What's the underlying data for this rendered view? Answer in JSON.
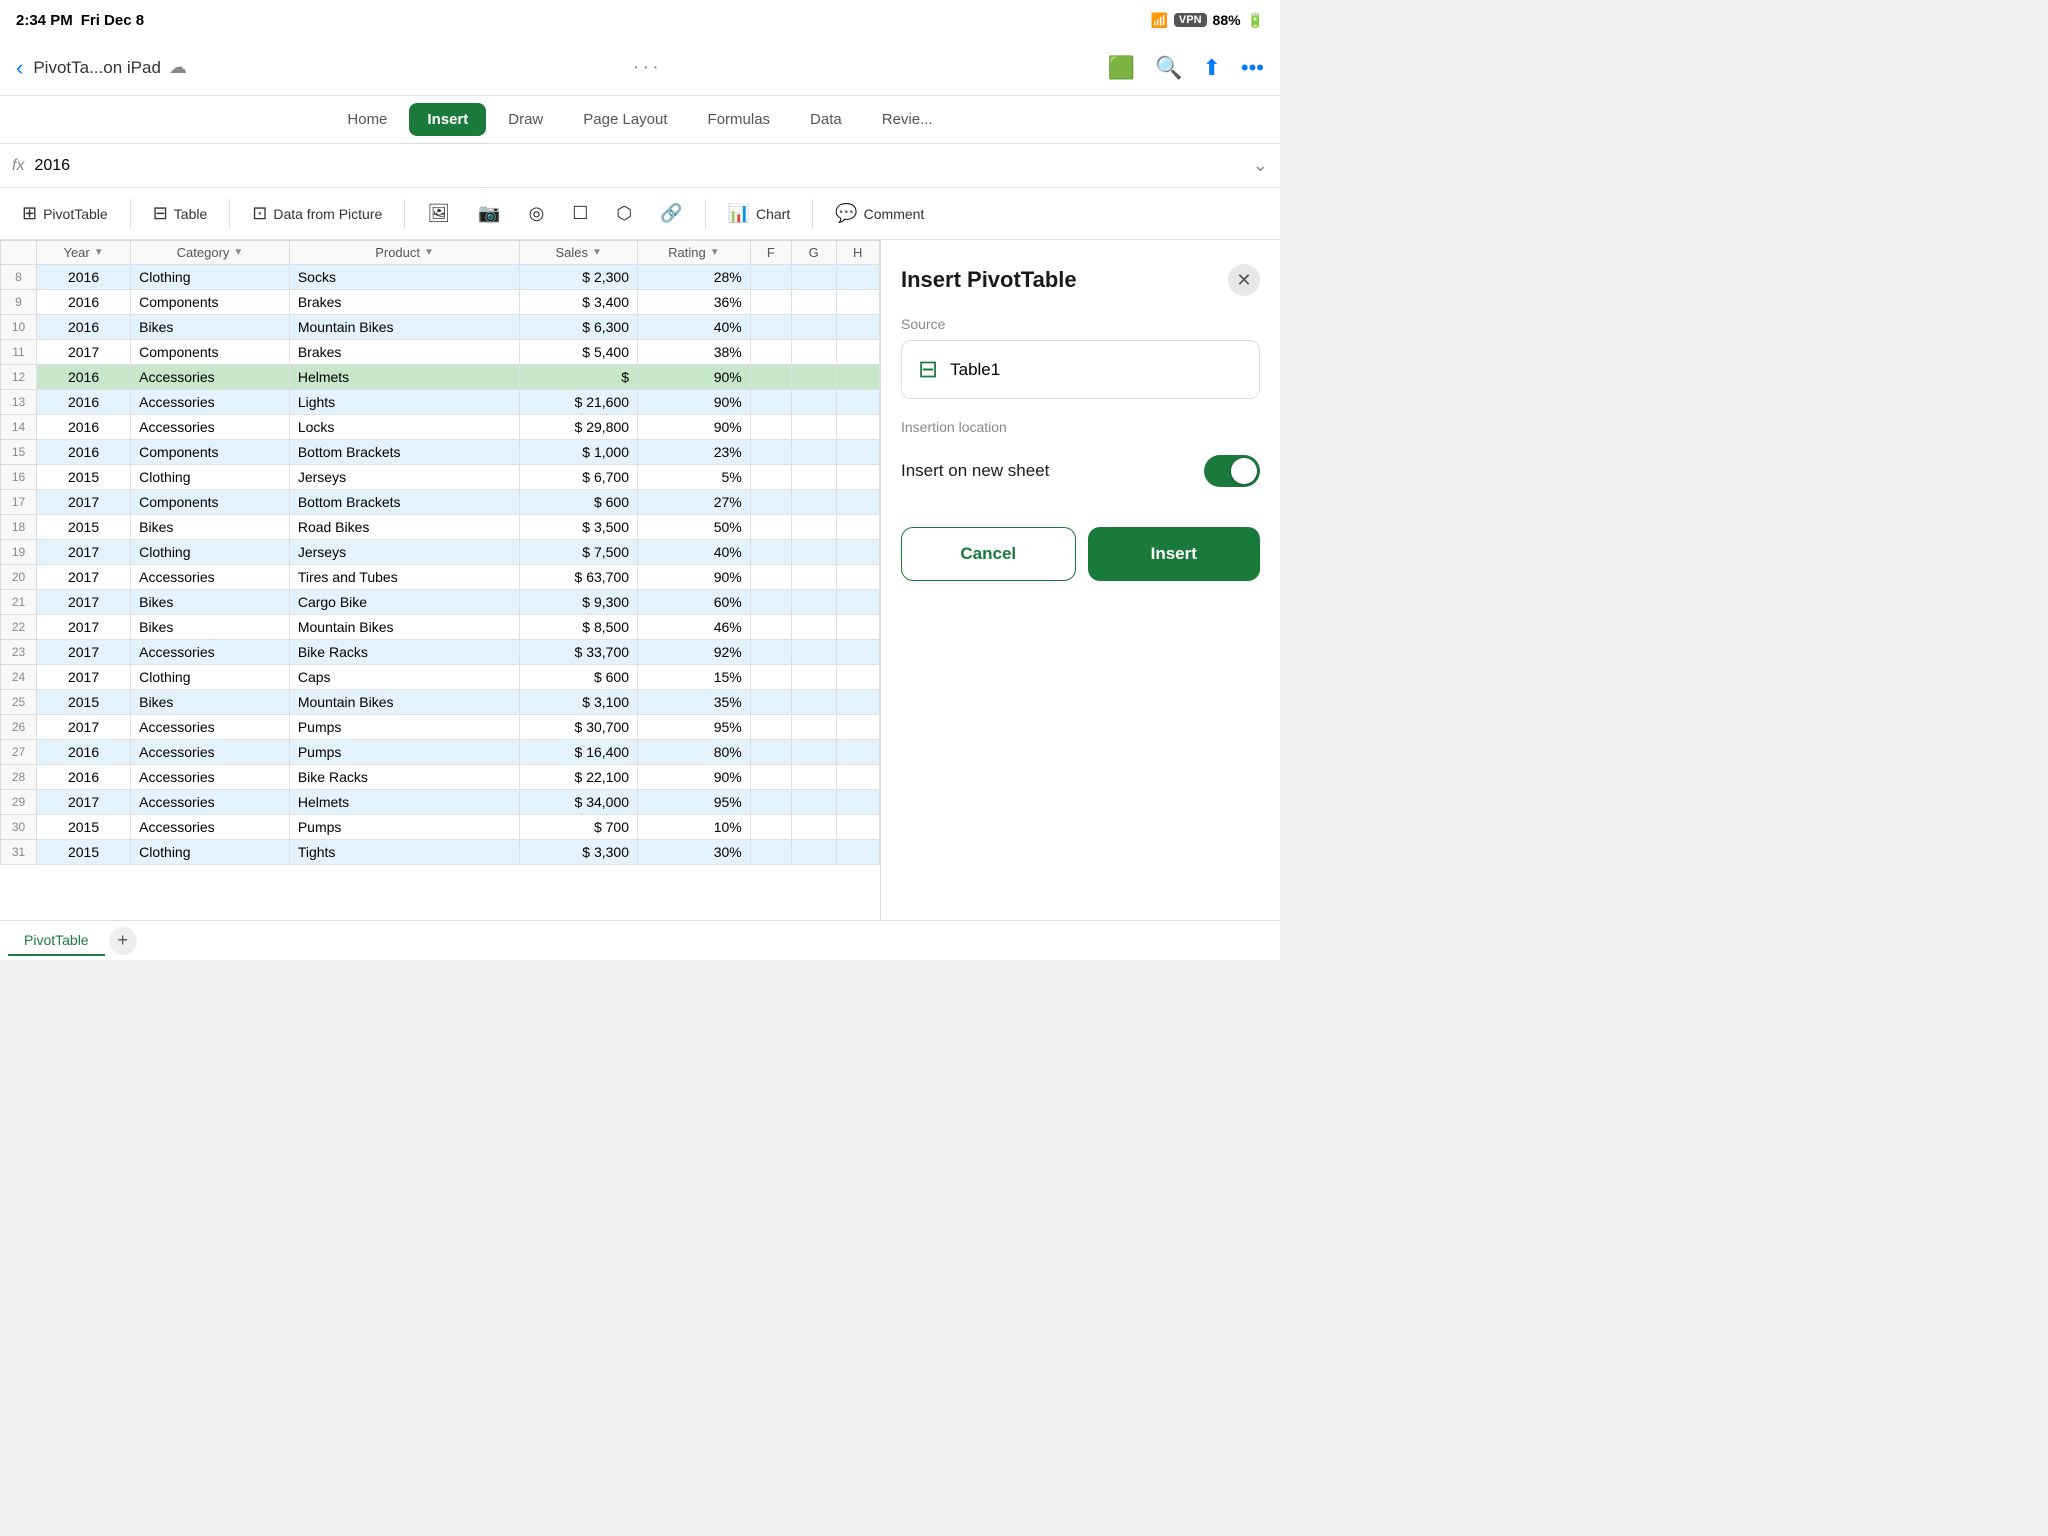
{
  "statusBar": {
    "time": "2:34 PM",
    "day": "Fri Dec 8",
    "vpn": "VPN",
    "battery": "88%",
    "batteryIcon": "🔋"
  },
  "titleBar": {
    "fileName": "PivotTa...on iPad",
    "backLabel": "‹"
  },
  "tabs": [
    {
      "id": "home",
      "label": "Home",
      "active": false
    },
    {
      "id": "insert",
      "label": "Insert",
      "active": true
    },
    {
      "id": "draw",
      "label": "Draw",
      "active": false
    },
    {
      "id": "pageLayout",
      "label": "Page Layout",
      "active": false
    },
    {
      "id": "formulas",
      "label": "Formulas",
      "active": false
    },
    {
      "id": "data",
      "label": "Data",
      "active": false
    },
    {
      "id": "review",
      "label": "Revie...",
      "active": false
    }
  ],
  "formulaBar": {
    "fx": "fx",
    "value": "2016"
  },
  "toolbar": {
    "items": [
      {
        "id": "pivottable",
        "label": "PivotTable",
        "icon": "⊞"
      },
      {
        "id": "table",
        "label": "Table",
        "icon": "⊟"
      },
      {
        "id": "datafrompicture",
        "label": "Data from Picture",
        "icon": "⊡"
      },
      {
        "id": "images",
        "label": "",
        "icon": "🖼"
      },
      {
        "id": "camera",
        "label": "",
        "icon": "📷"
      },
      {
        "id": "shapes",
        "label": "",
        "icon": "⬠"
      },
      {
        "id": "textbox",
        "label": "",
        "icon": "☐"
      },
      {
        "id": "scanner",
        "label": "",
        "icon": "⊞"
      },
      {
        "id": "links",
        "label": "",
        "icon": "🔗"
      },
      {
        "id": "chart",
        "label": "Chart",
        "icon": "📊"
      },
      {
        "id": "comment",
        "label": "Comment",
        "icon": "💬"
      }
    ]
  },
  "columns": [
    {
      "id": "year",
      "label": "Year",
      "hasFilter": true
    },
    {
      "id": "category",
      "label": "Category",
      "hasFilter": true
    },
    {
      "id": "product",
      "label": "Product",
      "hasFilter": true
    },
    {
      "id": "sales",
      "label": "Sales",
      "hasFilter": true
    },
    {
      "id": "rating",
      "label": "Rating",
      "hasFilter": true
    },
    {
      "id": "f",
      "label": "F",
      "hasFilter": false
    },
    {
      "id": "g",
      "label": "G",
      "hasFilter": false
    },
    {
      "id": "h",
      "label": "H",
      "hasFilter": false
    }
  ],
  "rows": [
    {
      "num": 8,
      "year": "2016",
      "category": "Clothing",
      "product": "Socks",
      "sales": "$ 2,300",
      "rating": "28%",
      "highlight": "blue"
    },
    {
      "num": 9,
      "year": "2016",
      "category": "Components",
      "product": "Brakes",
      "sales": "$ 3,400",
      "rating": "36%",
      "highlight": "normal"
    },
    {
      "num": 10,
      "year": "2016",
      "category": "Bikes",
      "product": "Mountain Bikes",
      "sales": "$ 6,300",
      "rating": "40%",
      "highlight": "blue"
    },
    {
      "num": 11,
      "year": "2017",
      "category": "Components",
      "product": "Brakes",
      "sales": "$ 5,400",
      "rating": "38%",
      "highlight": "normal"
    },
    {
      "num": 12,
      "year": "2016",
      "category": "Accessories",
      "product": "Helmets",
      "sales": "$",
      "rating": "90%",
      "highlight": "selected"
    },
    {
      "num": 13,
      "year": "2016",
      "category": "Accessories",
      "product": "Lights",
      "sales": "$ 21,600",
      "rating": "90%",
      "highlight": "blue"
    },
    {
      "num": 14,
      "year": "2016",
      "category": "Accessories",
      "product": "Locks",
      "sales": "$ 29,800",
      "rating": "90%",
      "highlight": "normal"
    },
    {
      "num": 15,
      "year": "2016",
      "category": "Components",
      "product": "Bottom Brackets",
      "sales": "$ 1,000",
      "rating": "23%",
      "highlight": "blue"
    },
    {
      "num": 16,
      "year": "2015",
      "category": "Clothing",
      "product": "Jerseys",
      "sales": "$ 6,700",
      "rating": "5%",
      "highlight": "normal"
    },
    {
      "num": 17,
      "year": "2017",
      "category": "Components",
      "product": "Bottom Brackets",
      "sales": "$ 600",
      "rating": "27%",
      "highlight": "blue"
    },
    {
      "num": 18,
      "year": "2015",
      "category": "Bikes",
      "product": "Road Bikes",
      "sales": "$ 3,500",
      "rating": "50%",
      "highlight": "normal"
    },
    {
      "num": 19,
      "year": "2017",
      "category": "Clothing",
      "product": "Jerseys",
      "sales": "$ 7,500",
      "rating": "40%",
      "highlight": "blue"
    },
    {
      "num": 20,
      "year": "2017",
      "category": "Accessories",
      "product": "Tires and Tubes",
      "sales": "$ 63,700",
      "rating": "90%",
      "highlight": "normal"
    },
    {
      "num": 21,
      "year": "2017",
      "category": "Bikes",
      "product": "Cargo Bike",
      "sales": "$ 9,300",
      "rating": "60%",
      "highlight": "blue"
    },
    {
      "num": 22,
      "year": "2017",
      "category": "Bikes",
      "product": "Mountain Bikes",
      "sales": "$ 8,500",
      "rating": "46%",
      "highlight": "normal"
    },
    {
      "num": 23,
      "year": "2017",
      "category": "Accessories",
      "product": "Bike Racks",
      "sales": "$ 33,700",
      "rating": "92%",
      "highlight": "blue"
    },
    {
      "num": 24,
      "year": "2017",
      "category": "Clothing",
      "product": "Caps",
      "sales": "$ 600",
      "rating": "15%",
      "highlight": "normal"
    },
    {
      "num": 25,
      "year": "2015",
      "category": "Bikes",
      "product": "Mountain Bikes",
      "sales": "$ 3,100",
      "rating": "35%",
      "highlight": "blue"
    },
    {
      "num": 26,
      "year": "2017",
      "category": "Accessories",
      "product": "Pumps",
      "sales": "$ 30,700",
      "rating": "95%",
      "highlight": "normal"
    },
    {
      "num": 27,
      "year": "2016",
      "category": "Accessories",
      "product": "Pumps",
      "sales": "$ 16,400",
      "rating": "80%",
      "highlight": "blue"
    },
    {
      "num": 28,
      "year": "2016",
      "category": "Accessories",
      "product": "Bike Racks",
      "sales": "$ 22,100",
      "rating": "90%",
      "highlight": "normal"
    },
    {
      "num": 29,
      "year": "2017",
      "category": "Accessories",
      "product": "Helmets",
      "sales": "$ 34,000",
      "rating": "95%",
      "highlight": "blue"
    },
    {
      "num": 30,
      "year": "2015",
      "category": "Accessories",
      "product": "Pumps",
      "sales": "$ 700",
      "rating": "10%",
      "highlight": "normal"
    },
    {
      "num": 31,
      "year": "2015",
      "category": "Clothing",
      "product": "Tights",
      "sales": "$ 3,300",
      "rating": "30%",
      "highlight": "blue"
    }
  ],
  "panel": {
    "title": "Insert PivotTable",
    "closeIcon": "✕",
    "sourceLabel": "Source",
    "sourceName": "Table1",
    "insertionLabel": "Insertion location",
    "insertOnNewSheet": "Insert on new sheet",
    "toggleOn": true,
    "cancelLabel": "Cancel",
    "insertLabel": "Insert"
  },
  "bottomBar": {
    "sheetName": "PivotTable",
    "addIcon": "+"
  },
  "colors": {
    "accent": "#1a7a3c",
    "selectedRow": "#c8e6c9",
    "blueRow": "#e3f2fd",
    "normalRow": "#ffffff"
  }
}
